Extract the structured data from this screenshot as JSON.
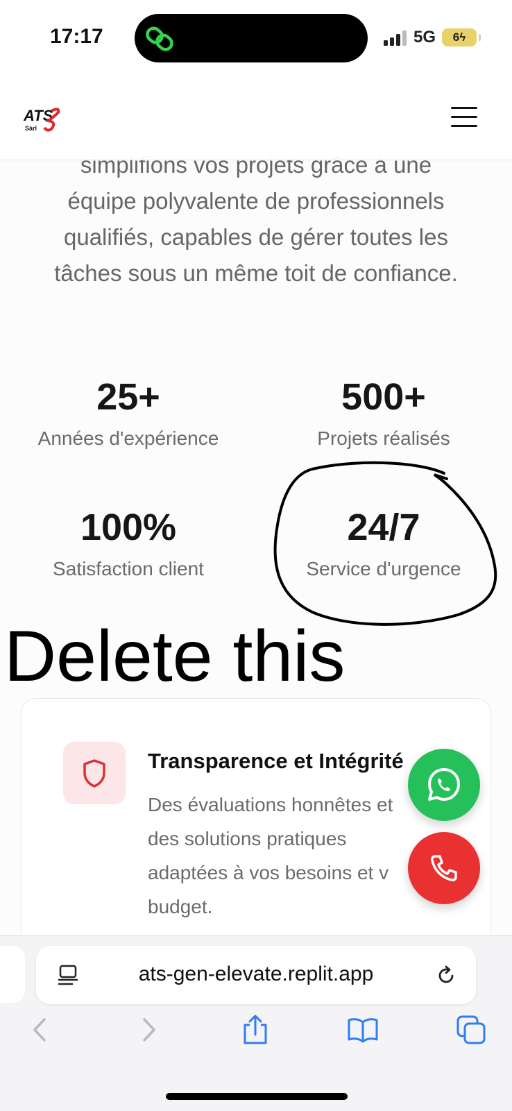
{
  "status_bar": {
    "time": "17:17",
    "network": "5G",
    "battery": "6"
  },
  "header": {
    "logo_text": "ATS",
    "logo_subtext": "Sàrl",
    "menu_icon": "hamburger-menu-icon"
  },
  "intro": {
    "lines": [
      "simplifions vos projets grâce à une",
      "équipe polyvalente de professionnels",
      "qualifiés, capables de gérer toutes les",
      "tâches sous un même toit de confiance."
    ]
  },
  "stats": [
    {
      "value": "25+",
      "label": "Années d'expérience"
    },
    {
      "value": "500+",
      "label": "Projets réalisés"
    },
    {
      "value": "100%",
      "label": "Satisfaction client"
    },
    {
      "value": "24/7",
      "label": "Service d'urgence"
    }
  ],
  "annotation": {
    "text": "Delete this"
  },
  "card": {
    "icon": "shield-icon",
    "title": "Transparence et Intégrité",
    "text_lines": [
      "Des évaluations honnêtes et",
      "des solutions pratiques",
      "adaptées à vos besoins et v",
      "budget."
    ]
  },
  "fabs": {
    "whatsapp_icon": "whatsapp-icon",
    "call_icon": "phone-icon"
  },
  "browser": {
    "url": "ats-gen-elevate.replit.app"
  },
  "colors": {
    "accent_red": "#ea3131",
    "whatsapp_green": "#25c05a",
    "ios_blue": "#2f7cf6"
  }
}
